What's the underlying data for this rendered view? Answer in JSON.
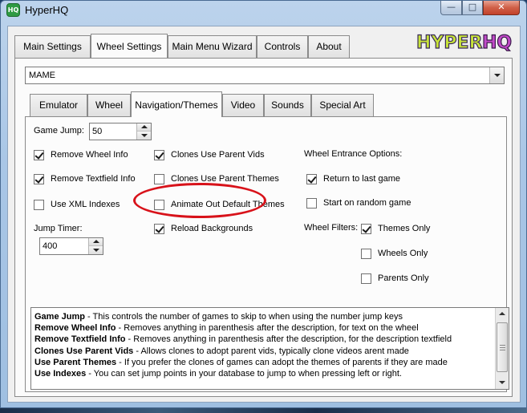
{
  "window": {
    "title": "HyperHQ",
    "icon_text": "HQ",
    "controls": {
      "minimize": "—",
      "maximize": "□",
      "close": "✕"
    }
  },
  "logo": {
    "text": "HYPER HQ",
    "colors": {
      "hyper": "#c7e33a",
      "hq": "#c24bc9"
    }
  },
  "main_tabs": [
    {
      "label": "Main Settings",
      "active": false
    },
    {
      "label": "Wheel Settings",
      "active": true
    },
    {
      "label": "Main Menu Wizard",
      "active": false
    },
    {
      "label": "Controls",
      "active": false
    },
    {
      "label": "About",
      "active": false
    }
  ],
  "system_select": {
    "value": "MAME"
  },
  "sub_tabs": [
    {
      "label": "Emulator",
      "active": false
    },
    {
      "label": "Wheel",
      "active": false
    },
    {
      "label": "Navigation/Themes",
      "active": true
    },
    {
      "label": "Video",
      "active": false
    },
    {
      "label": "Sounds",
      "active": false
    },
    {
      "label": "Special Art",
      "active": false
    }
  ],
  "form": {
    "game_jump": {
      "label": "Game Jump:",
      "value": "50"
    },
    "jump_timer": {
      "label": "Jump Timer:",
      "value": "400"
    },
    "checkboxes": {
      "remove_wheel_info": {
        "label": "Remove Wheel Info",
        "checked": true
      },
      "remove_textfield_info": {
        "label": "Remove Textfield Info",
        "checked": true
      },
      "use_xml_indexes": {
        "label": "Use XML Indexes",
        "checked": false
      },
      "clones_use_parent_vids": {
        "label": "Clones Use Parent Vids",
        "checked": true
      },
      "clones_use_parent_themes": {
        "label": "Clones Use Parent Themes",
        "checked": false
      },
      "animate_out_default_themes": {
        "label": "Animate Out Default Themes",
        "checked": false
      },
      "reload_backgrounds": {
        "label": "Reload Backgrounds",
        "checked": true
      },
      "return_to_last_game": {
        "label": "Return to last game",
        "checked": true
      },
      "start_on_random_game": {
        "label": "Start on random game",
        "checked": false
      },
      "themes_only": {
        "label": "Themes Only",
        "checked": true
      },
      "wheels_only": {
        "label": "Wheels Only",
        "checked": false
      },
      "parents_only": {
        "label": "Parents Only",
        "checked": false
      }
    },
    "wheel_entrance_label": "Wheel Entrance Options:",
    "wheel_filters_label": "Wheel Filters:"
  },
  "annotation": {
    "color": "#d8121a"
  },
  "help": [
    {
      "term": "Game Jump",
      "text": " - This controls the number of games to skip to when using the number jump keys"
    },
    {
      "term": "Remove Wheel Info",
      "text": " - Removes anything in parenthesis after the description, for text on the wheel"
    },
    {
      "term": "Remove Textfield Info",
      "text": " - Removes anything in parenthesis after the description, for the description textfield"
    },
    {
      "term": "Clones Use Parent Vids",
      "text": " - Allows clones to adopt parent vids, typically clone videos arent made"
    },
    {
      "term": "Use Parent Themes",
      "text": " - If you prefer the clones of games can adopt the themes of parents if they are made"
    },
    {
      "term": "Use Indexes",
      "text": " - You can set jump points in your database to jump to when pressing left or right."
    }
  ]
}
